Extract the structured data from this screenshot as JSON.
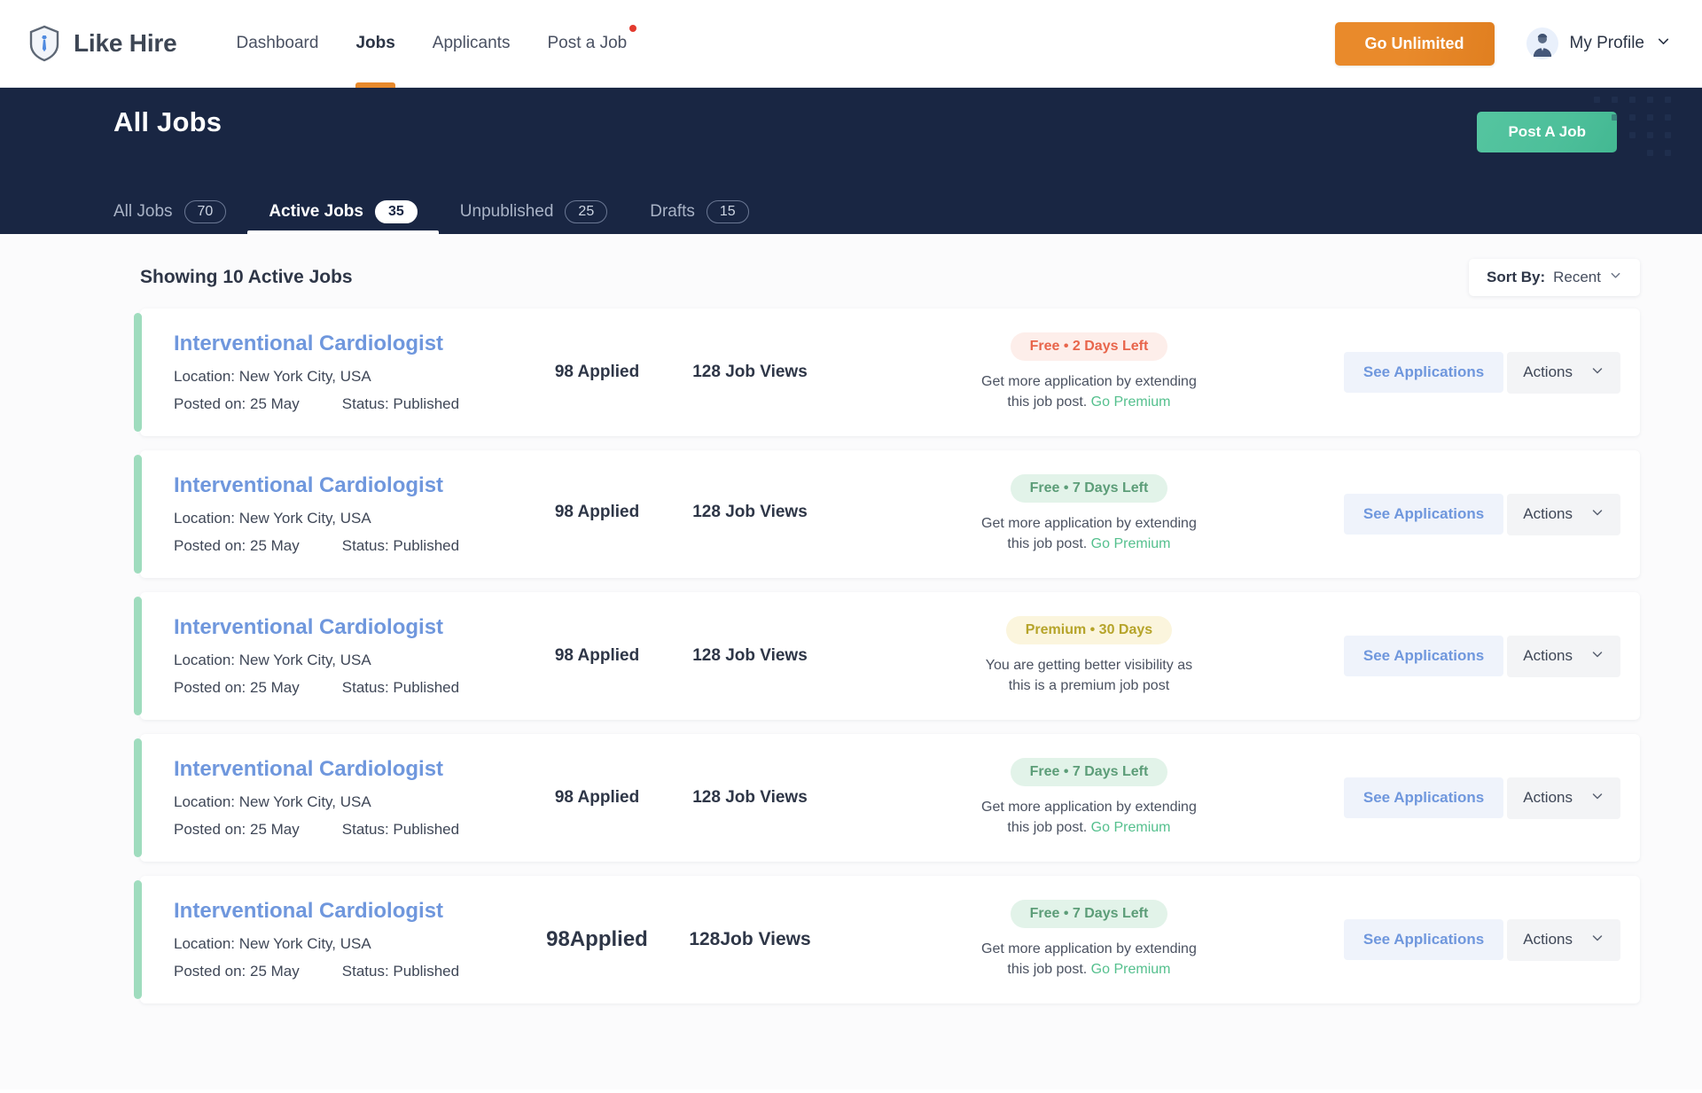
{
  "header": {
    "brand": "Like Hire",
    "logo_icon": "shield-tie-icon",
    "nav": [
      {
        "label": "Dashboard",
        "active": false,
        "dot": false
      },
      {
        "label": "Jobs",
        "active": true,
        "dot": false
      },
      {
        "label": "Applicants",
        "active": false,
        "dot": false
      },
      {
        "label": "Post a Job",
        "active": false,
        "dot": true
      }
    ],
    "go_unlimited": "Go Unlimited",
    "profile_name": "My Profile",
    "profile_icon": "avatar",
    "profile_chevron": "chevron-down-icon"
  },
  "banner": {
    "title": "All Jobs",
    "post_job": "Post A Job",
    "bg_color": "#192643",
    "post_job_color": "#4dbf9a"
  },
  "tabs": [
    {
      "label": "All Jobs",
      "count": "70",
      "active": false
    },
    {
      "label": "Active Jobs",
      "count": "35",
      "active": true
    },
    {
      "label": "Unpublished",
      "count": "25",
      "active": false
    },
    {
      "label": "Drafts",
      "count": "15",
      "active": false
    }
  ],
  "list": {
    "showing": "Showing 10 Active Jobs",
    "sort_label": "Sort By:",
    "sort_value": "Recent",
    "sort_chevron": "chevron-down-icon"
  },
  "buttons": {
    "see_applications": "See Applications",
    "actions": "Actions",
    "actions_chevron": "chevron-down-icon"
  },
  "jobs": [
    {
      "title": "Interventional Cardiologist",
      "location": "Location: New York City, USA",
      "posted": "Posted on: 25 May",
      "status": "Status: Published",
      "applied": "98 Applied",
      "views": "128 Job Views",
      "badge": "Free • 2 Days Left",
      "badge_style": "free-red",
      "promo_text": "Get more application by extending this job post. ",
      "promo_link": "Go Premium",
      "accent_color": "#9fdcbe"
    },
    {
      "title": "Interventional Cardiologist",
      "location": "Location: New York City, USA",
      "posted": "Posted on: 25 May",
      "status": "Status: Published",
      "applied": "98 Applied",
      "views": "128 Job Views",
      "badge": "Free • 7 Days Left",
      "badge_style": "free-green",
      "promo_text": "Get more application by extending this job post. ",
      "promo_link": "Go Premium",
      "accent_color": "#9fdcbe"
    },
    {
      "title": "Interventional Cardiologist",
      "location": "Location: New York City, USA",
      "posted": "Posted on: 25 May",
      "status": "Status: Published",
      "applied": "98 Applied",
      "views": "128 Job Views",
      "badge": "Premium • 30 Days",
      "badge_style": "premium",
      "promo_text": "You are getting better visibility as this is a premium job post",
      "promo_link": "",
      "accent_color": "#9fdcbe"
    },
    {
      "title": "Interventional Cardiologist",
      "location": "Location: New York City, USA",
      "posted": "Posted on: 25 May",
      "status": "Status: Published",
      "applied": "98 Applied",
      "views": "128 Job Views",
      "badge": "Free • 7 Days Left",
      "badge_style": "free-green",
      "promo_text": "Get more application by extending this job post. ",
      "promo_link": "Go Premium",
      "accent_color": "#9fdcbe"
    },
    {
      "title": "Interventional Cardiologist",
      "location": "Location: New York City, USA",
      "posted": "Posted on: 25 May",
      "status": "Status: Published",
      "applied": "98Applied",
      "views": "128Job Views",
      "badge": "Free • 7 Days Left",
      "badge_style": "free-green",
      "promo_text": "Get more application by extending this job post. ",
      "promo_link": "Go Premium",
      "accent_color": "#9fdcbe"
    }
  ]
}
